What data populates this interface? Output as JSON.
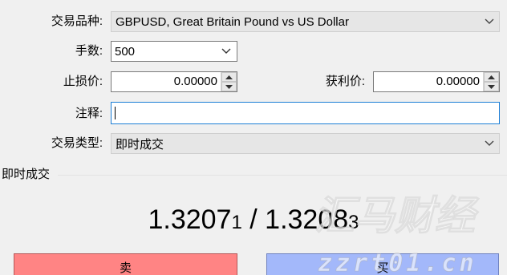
{
  "form": {
    "symbol_label": "交易品种:",
    "symbol_value": "GBPUSD, Great Britain Pound vs US Dollar",
    "volume_label": "手数:",
    "volume_value": "500",
    "stoploss_label": "止损价:",
    "stoploss_value": "0.00000",
    "takeprofit_label": "获利价:",
    "takeprofit_value": "0.00000",
    "comment_label": "注释:",
    "comment_value": "",
    "type_label": "交易类型:",
    "type_value": "即时成交"
  },
  "section": {
    "title": "即时成交"
  },
  "quote": {
    "bid_main": "1.3207",
    "bid_small": "1",
    "separator": " / ",
    "ask_main": "1.3208",
    "ask_small": "3"
  },
  "buttons": {
    "sell": "卖",
    "buy": "买"
  },
  "watermark": {
    "line1": "汇马财经",
    "line2": "zzrt01.cn"
  },
  "icons": [
    "chevron-down-icon",
    "spin-up-icon",
    "spin-down-icon"
  ]
}
